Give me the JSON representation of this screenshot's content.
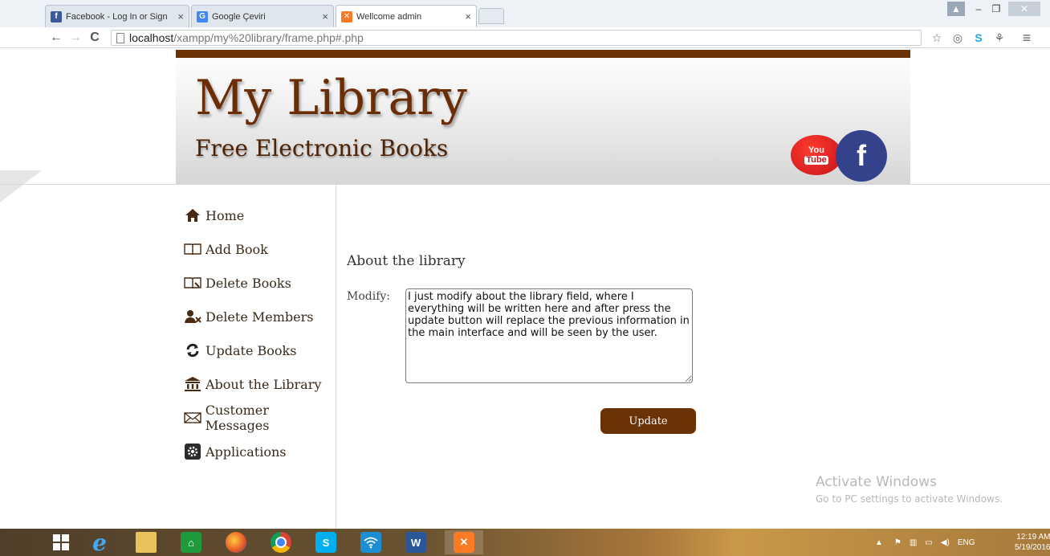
{
  "browser": {
    "tabs": [
      {
        "title": "Facebook - Log In or Sign",
        "close": "×",
        "favicon": "facebook-icon",
        "color": "#3b5998"
      },
      {
        "title": "Google Çeviri",
        "close": "×",
        "favicon": "google-translate-icon",
        "color": "#4285f4"
      },
      {
        "title": "Wellcome admin",
        "close": "×",
        "favicon": "xampp-icon",
        "color": "#fb7a24"
      }
    ],
    "url_host": "localhost",
    "url_path": "/xampp/my%20library/frame.php#.php"
  },
  "header": {
    "title": "My Library",
    "subtitle": "Free Electronic Books",
    "youtube_you": "You",
    "youtube_tube": "Tube",
    "facebook_letter": "f"
  },
  "sidebar": {
    "items": [
      {
        "label": "Home",
        "icon": "home-icon"
      },
      {
        "label": "Add Book",
        "icon": "open-book-icon"
      },
      {
        "label": "Delete Books",
        "icon": "delete-book-icon"
      },
      {
        "label": "Delete Members",
        "icon": "delete-user-icon"
      },
      {
        "label": "Update Books",
        "icon": "refresh-icon"
      },
      {
        "label": "About the Library",
        "icon": "library-building-icon"
      },
      {
        "label": "Customer Messages",
        "icon": "envelope-icon"
      },
      {
        "label": "Applications",
        "icon": "gear-icon"
      }
    ]
  },
  "main": {
    "heading": "About the library",
    "modify_label": "Modify:",
    "about_text": "I just modify about the library field, where I everything will be written here and after press the update button will replace the previous information in the main interface and will be seen by the user.",
    "update_button": "Update"
  },
  "watermark": {
    "title": "Activate Windows",
    "subtitle": "Go to PC settings to activate Windows."
  },
  "taskbar": {
    "language": "ENG",
    "time": "12:19 AM",
    "date": "5/19/2016"
  },
  "colors": {
    "brand_brown": "#6b3205",
    "title_brown": "#6b2d06"
  }
}
